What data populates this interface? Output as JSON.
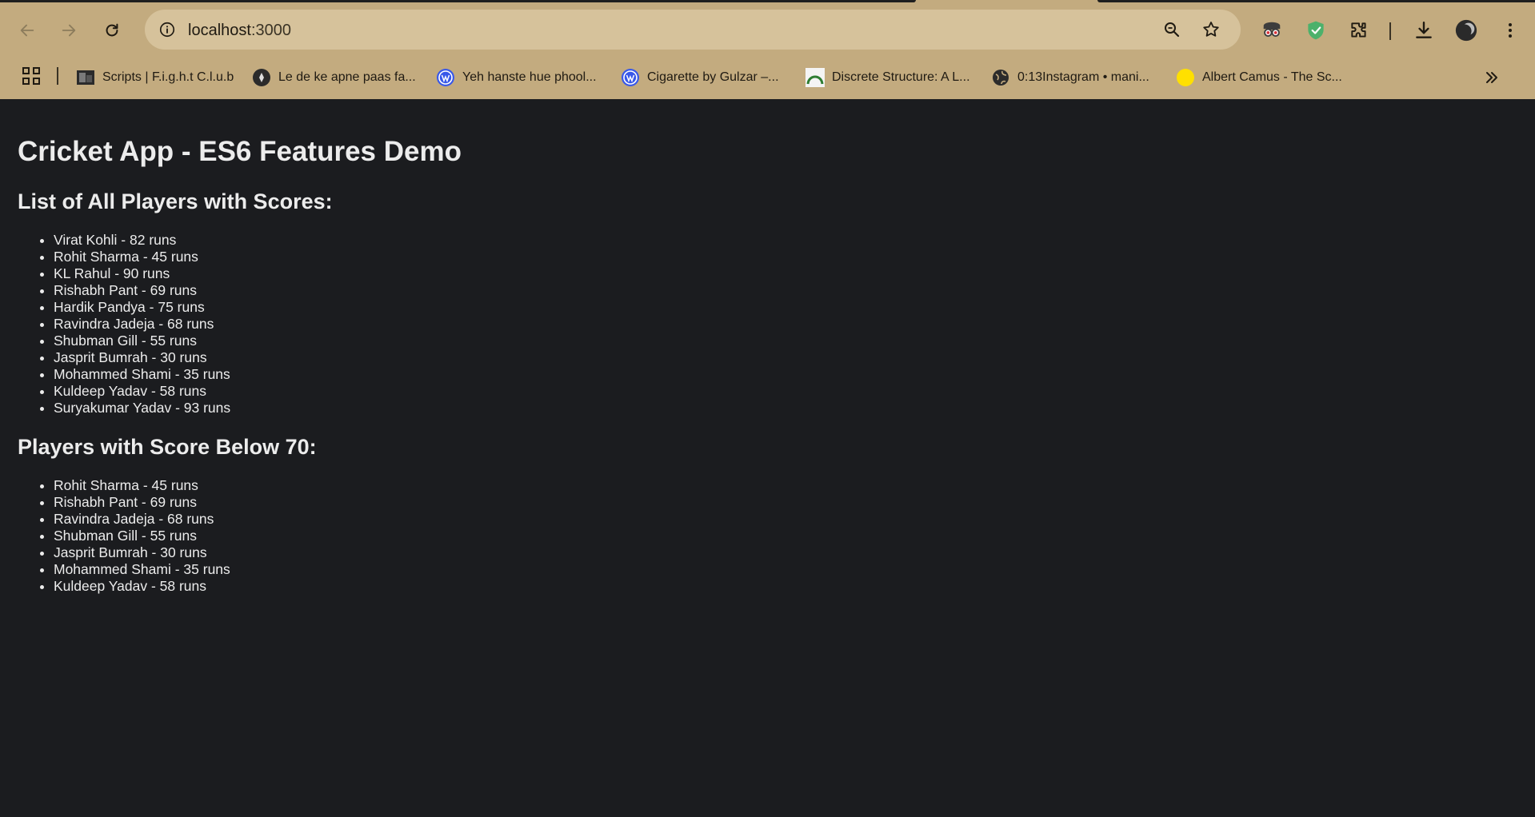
{
  "browser": {
    "url_host": "localhost",
    "url_port": ":3000",
    "bookmarks": [
      {
        "label": "Scripts | F.i.g.h.t C.l.u.b"
      },
      {
        "label": "Le de ke apne paas fa..."
      },
      {
        "label": "Yeh hanste hue phool..."
      },
      {
        "label": "Cigarette by Gulzar –..."
      },
      {
        "label": "Discrete Structure: A L..."
      },
      {
        "label": "0:13Instagram • mani..."
      },
      {
        "label": "Albert Camus - The Sc..."
      }
    ],
    "chrome_color": "#c3ab7f",
    "omnibox_color": "#d6c29b"
  },
  "page": {
    "title": "Cricket App - ES6 Features Demo",
    "all_players_heading": "List of All Players with Scores:",
    "all_players": [
      "Virat Kohli - 82 runs",
      "Rohit Sharma - 45 runs",
      "KL Rahul - 90 runs",
      "Rishabh Pant - 69 runs",
      "Hardik Pandya - 75 runs",
      "Ravindra Jadeja - 68 runs",
      "Shubman Gill - 55 runs",
      "Jasprit Bumrah - 30 runs",
      "Mohammed Shami - 35 runs",
      "Kuldeep Yadav - 58 runs",
      "Suryakumar Yadav - 93 runs"
    ],
    "below70_heading": "Players with Score Below 70:",
    "below70_players": [
      "Rohit Sharma - 45 runs",
      "Rishabh Pant - 69 runs",
      "Ravindra Jadeja - 68 runs",
      "Shubman Gill - 55 runs",
      "Jasprit Bumrah - 30 runs",
      "Mohammed Shami - 35 runs",
      "Kuldeep Yadav - 58 runs"
    ],
    "background": "#1b1c1f"
  }
}
